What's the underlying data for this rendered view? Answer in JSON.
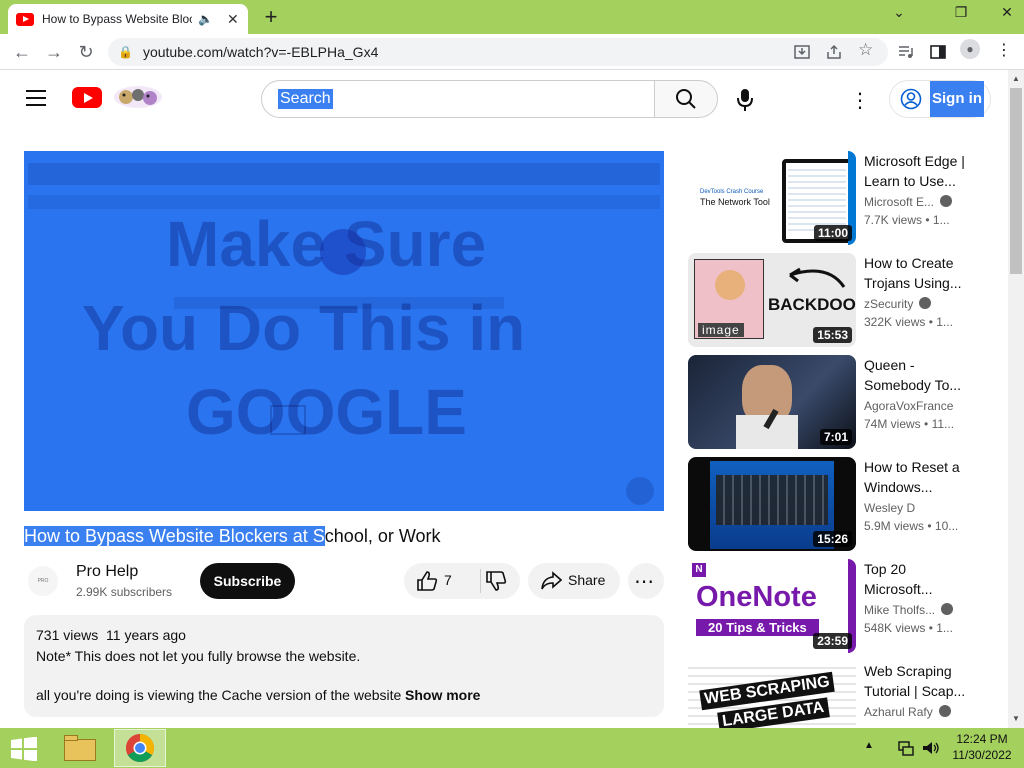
{
  "browser": {
    "tab_title": "How to Bypass Website Blocker",
    "new_tab": "+",
    "url": "youtube.com/watch?v=-EBLPHa_Gx4",
    "controls": {
      "minimize": "⌄",
      "restore": "❐",
      "close": "✕"
    }
  },
  "youtube": {
    "search_placeholder": "Search",
    "sign_in_label": "Sign in"
  },
  "video": {
    "overlay_text": [
      "Make Sure",
      "You Do This in",
      "GOOGLE"
    ],
    "title_selected": "How to Bypass Website Blockers at S",
    "title_rest": "chool, or Work",
    "channel_avatar_text": "PRO",
    "channel_name": "Pro Help",
    "subscribers": "2.99K subscribers",
    "subscribe_label": "Subscribe",
    "likes": "7",
    "share_label": "Share"
  },
  "description": {
    "views": "731 views",
    "age": "11 years ago",
    "line1": "Note* This does not let you fully browse the website.",
    "line2": "all you're doing is viewing the Cache version of the website",
    "show_more": "Show more"
  },
  "recommendations": [
    {
      "title": "Microsoft Edge | Learn to Use...",
      "channel": "Microsoft E...",
      "verified": true,
      "views": "7.7K views",
      "age": "1...",
      "duration": "11:00",
      "thumb_text": "DevTools Crash Course\nThe Network Tool"
    },
    {
      "title": "How to Create Trojans Using...",
      "channel": "zSecurity",
      "verified": true,
      "views": "322K views",
      "age": "1...",
      "duration": "15:53",
      "thumb_text": "BACKDOOR",
      "thumb_sub": "image"
    },
    {
      "title": "Queen - Somebody To...",
      "channel": "AgoraVoxFrance",
      "verified": false,
      "views": "74M views",
      "age": "11...",
      "duration": "7:01"
    },
    {
      "title": "How to Reset a Windows...",
      "channel": "Wesley D",
      "verified": false,
      "views": "5.9M views",
      "age": "10...",
      "duration": "15:26"
    },
    {
      "title": "Top 20 Microsoft...",
      "channel": "Mike Tholfs...",
      "verified": true,
      "views": "548K views",
      "age": "1...",
      "duration": "23:59",
      "thumb_text": "OneNote",
      "thumb_sub": "20 Tips & Tricks"
    },
    {
      "title": "Web Scraping Tutorial | Scap...",
      "channel": "Azharul Rafy",
      "verified": true,
      "views": "",
      "age": "",
      "duration": "",
      "thumb_text": "WEB SCRAPING",
      "thumb_sub": "LARGE DATA"
    }
  ],
  "taskbar": {
    "time": "12:24 PM",
    "date": "11/30/2022"
  },
  "colors": {
    "accent_green": "#a4d05e",
    "youtube_red": "#ff0000",
    "selection_blue": "#3b80f0"
  }
}
